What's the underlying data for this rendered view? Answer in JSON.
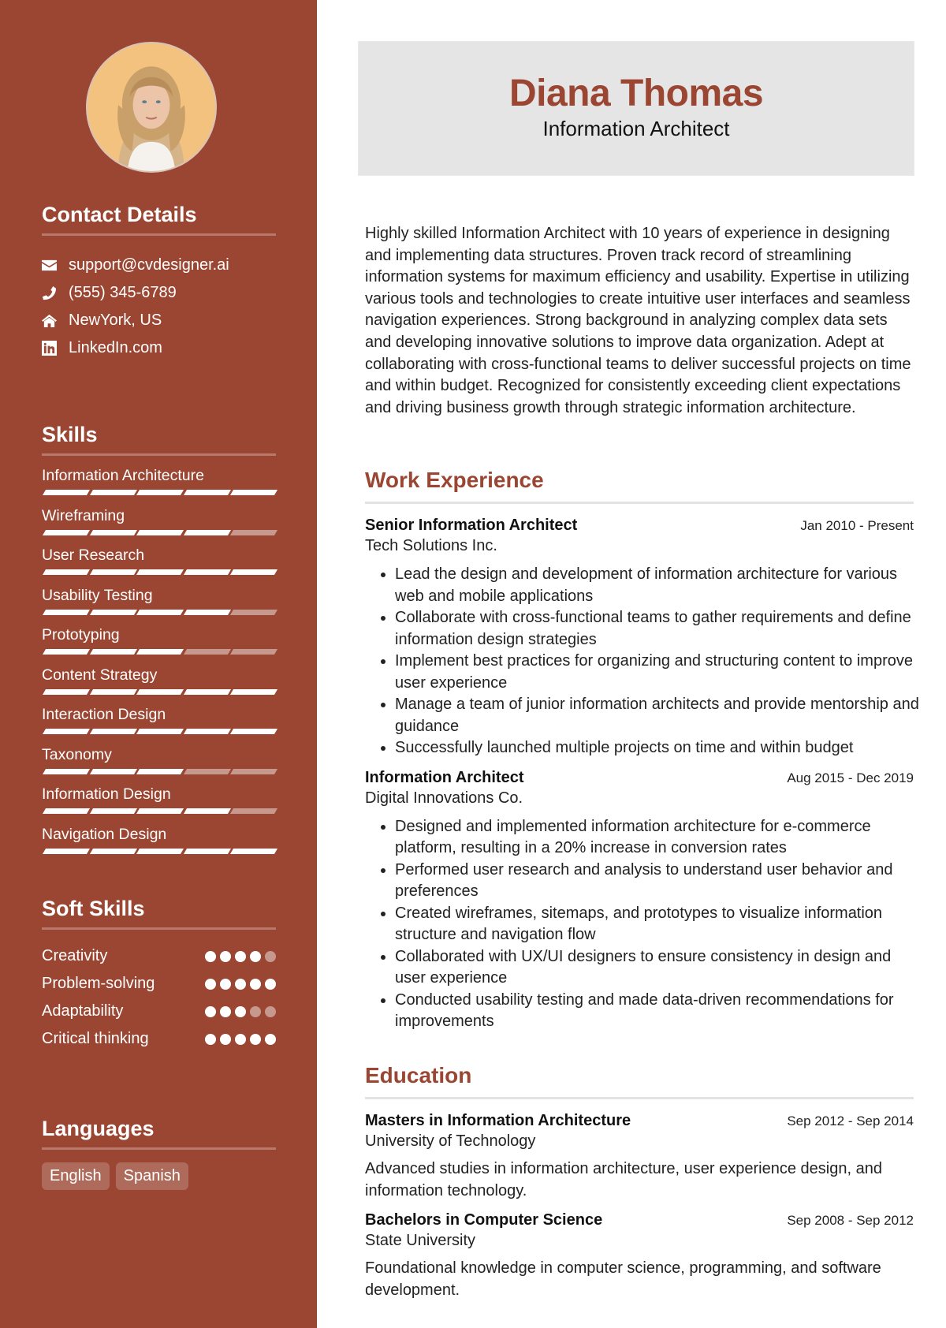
{
  "profile": {
    "name": "Diana Thomas",
    "title": "Information Architect",
    "photo_alt": "profile-photo"
  },
  "contact": {
    "heading": "Contact Details",
    "items": [
      {
        "icon": "envelope-icon",
        "text": "support@cvdesigner.ai"
      },
      {
        "icon": "phone-icon",
        "text": "(555) 345-6789"
      },
      {
        "icon": "home-icon",
        "text": "NewYork, US"
      },
      {
        "icon": "linkedin-icon",
        "text": "LinkedIn.com"
      }
    ]
  },
  "skills": {
    "heading": "Skills",
    "max_level": 5,
    "items": [
      {
        "label": "Information Architecture",
        "level": 5
      },
      {
        "label": "Wireframing",
        "level": 4
      },
      {
        "label": "User Research",
        "level": 5
      },
      {
        "label": "Usability Testing",
        "level": 4
      },
      {
        "label": "Prototyping",
        "level": 3
      },
      {
        "label": "Content Strategy",
        "level": 5
      },
      {
        "label": "Interaction Design",
        "level": 5
      },
      {
        "label": "Taxonomy",
        "level": 3
      },
      {
        "label": "Information Design",
        "level": 4
      },
      {
        "label": "Navigation Design",
        "level": 5
      }
    ]
  },
  "soft_skills": {
    "heading": "Soft Skills",
    "max_level": 5,
    "items": [
      {
        "label": "Creativity",
        "level": 4
      },
      {
        "label": "Problem-solving",
        "level": 5
      },
      {
        "label": "Adaptability",
        "level": 3
      },
      {
        "label": "Critical thinking",
        "level": 5
      }
    ]
  },
  "languages": {
    "heading": "Languages",
    "items": [
      "English",
      "Spanish"
    ]
  },
  "summary": "Highly skilled Information Architect with 10 years of experience in designing and implementing data structures. Proven track record of streamlining information systems for maximum efficiency and usability. Expertise in utilizing various tools and technologies to create intuitive user interfaces and seamless navigation experiences. Strong background in analyzing complex data sets and developing innovative solutions to improve data organization. Adept at collaborating with cross-functional teams to deliver successful projects on time and within budget. Recognized for consistently exceeding client expectations and driving business growth through strategic information architecture.",
  "experience": {
    "heading": "Work Experience",
    "jobs": [
      {
        "role": "Senior Information Architect",
        "company": "Tech Solutions Inc.",
        "dates": "Jan 2010 - Present",
        "bullets": [
          "Lead the design and development of information architecture for various web and mobile applications",
          "Collaborate with cross-functional teams to gather requirements and define information design strategies",
          "Implement best practices for organizing and structuring content to improve user experience",
          "Manage a team of junior information architects and provide mentorship and guidance",
          "Successfully launched multiple projects on time and within budget"
        ]
      },
      {
        "role": "Information Architect",
        "company": "Digital Innovations Co.",
        "dates": "Aug 2015 - Dec 2019",
        "bullets": [
          "Designed and implemented information architecture for e-commerce platform, resulting in a 20% increase in conversion rates",
          "Performed user research and analysis to understand user behavior and preferences",
          "Created wireframes, sitemaps, and prototypes to visualize information structure and navigation flow",
          "Collaborated with UX/UI designers to ensure consistency in design and user experience",
          "Conducted usability testing and made data-driven recommendations for improvements"
        ]
      }
    ]
  },
  "education": {
    "heading": "Education",
    "items": [
      {
        "degree": "Masters in Information Architecture",
        "school": "University of Technology",
        "dates": "Sep 2012 - Sep 2014",
        "description": "Advanced studies in information architecture, user experience design, and information technology."
      },
      {
        "degree": "Bachelors in Computer Science",
        "school": "State University",
        "dates": "Sep 2008 - Sep 2012",
        "description": "Foundational knowledge in computer science, programming, and software development."
      }
    ]
  },
  "colors": {
    "accent": "#9a4632",
    "header_bg": "#e5e5e5",
    "rule": "#e3e3e3"
  }
}
